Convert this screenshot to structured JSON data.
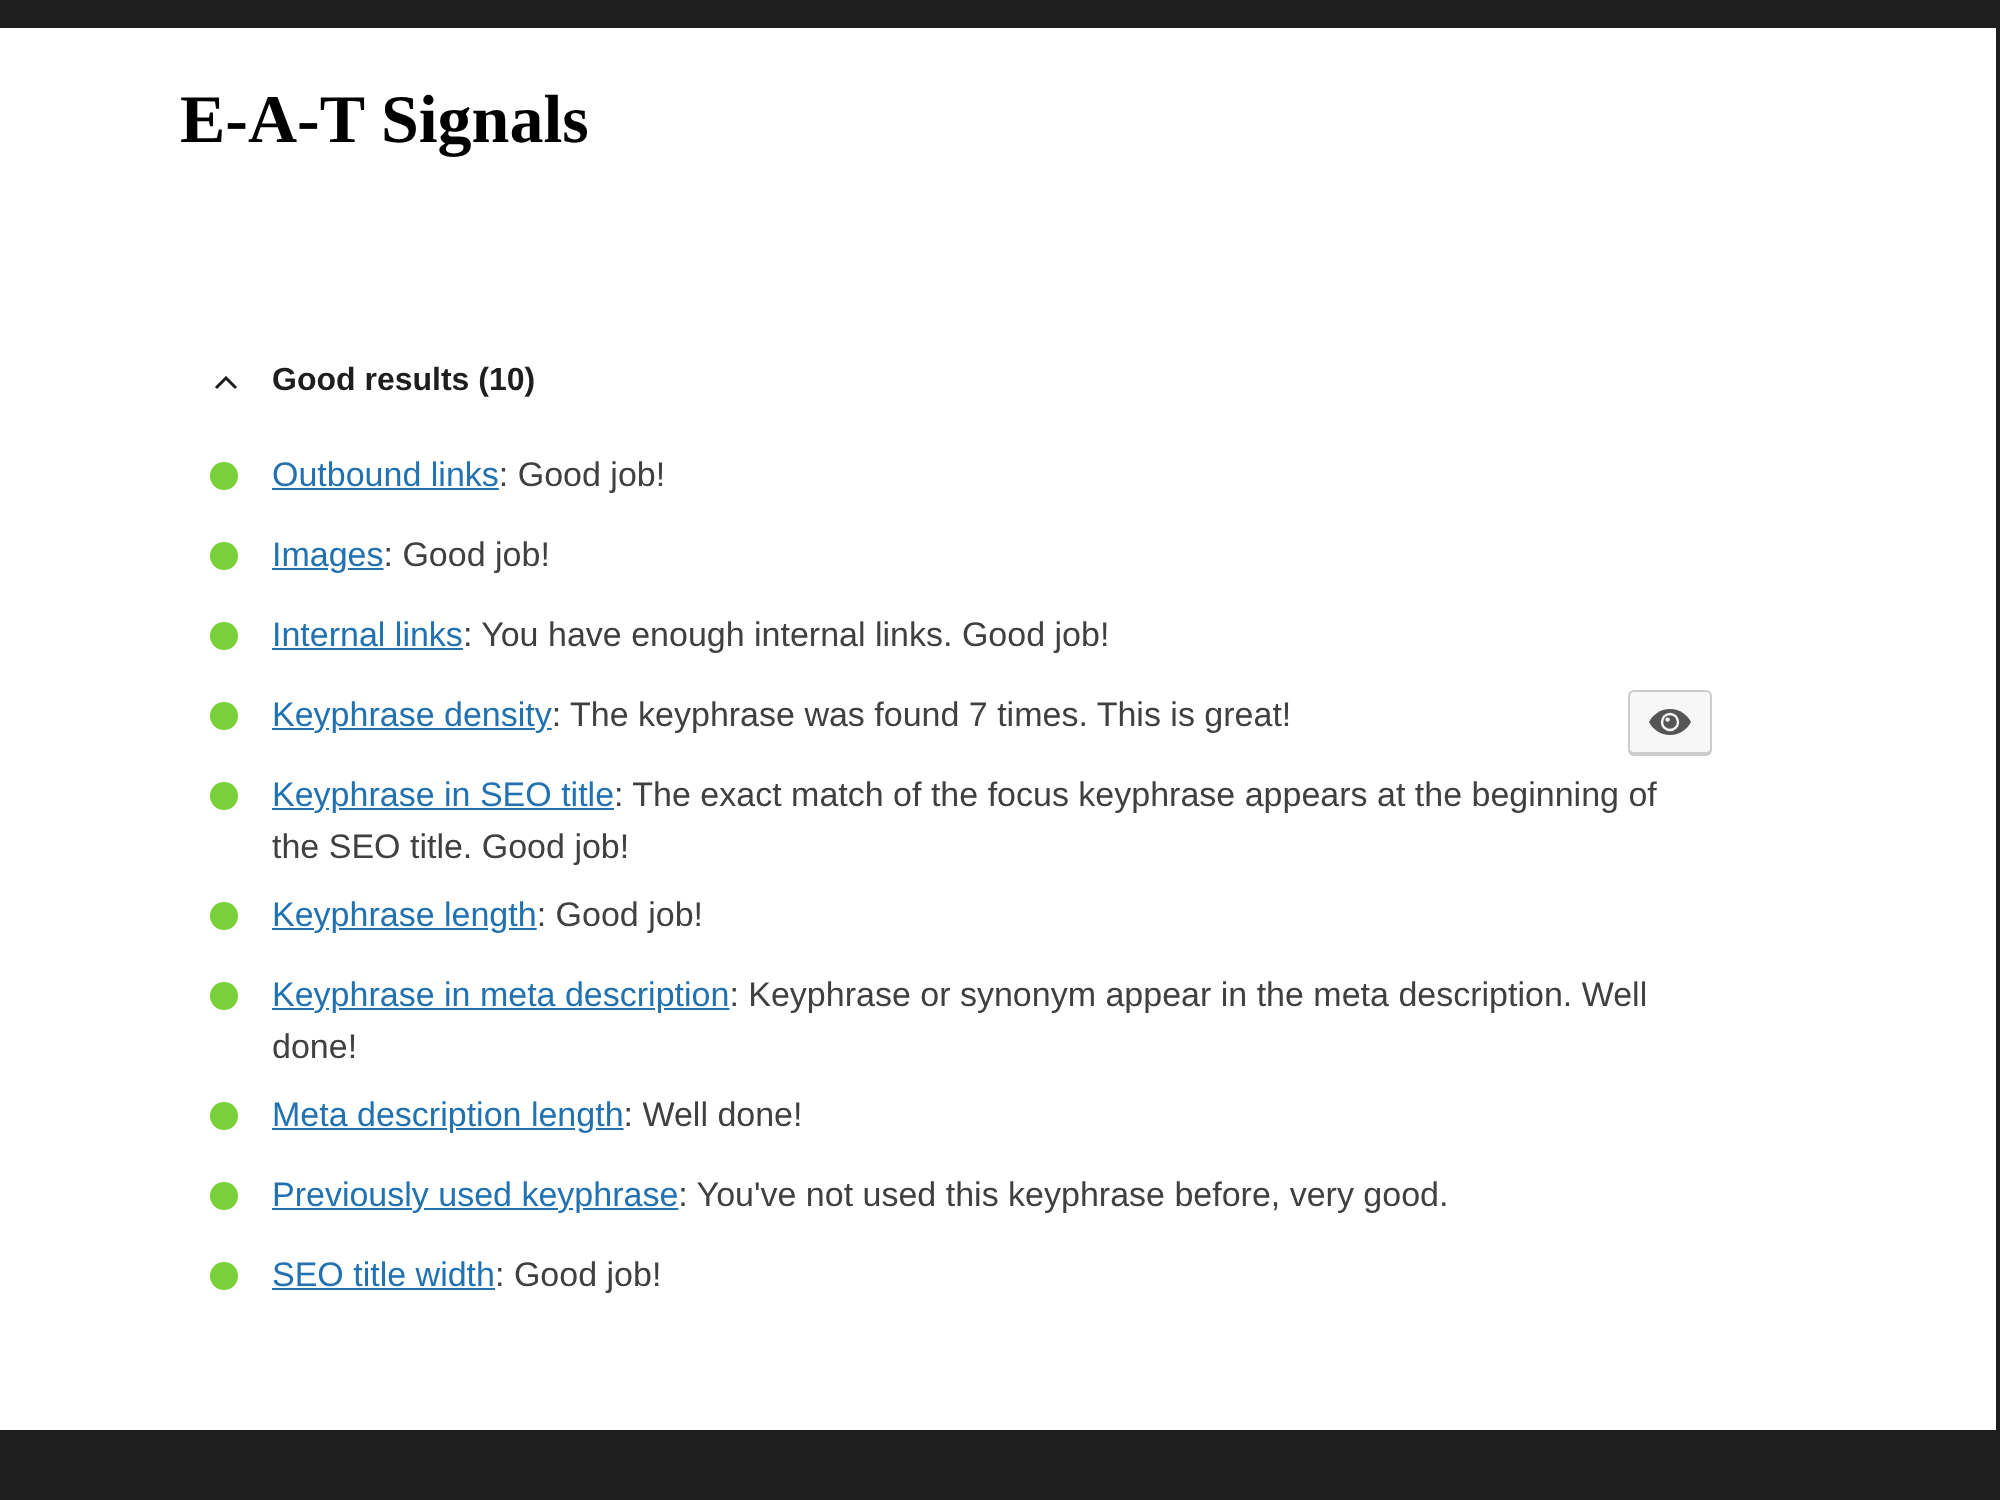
{
  "title": "E-A-T Signals",
  "results": {
    "heading": "Good results (10)",
    "expanded": true,
    "items": [
      {
        "link": "Outbound links",
        "message": ": Good job!",
        "color": "#7ad03a",
        "marker_button": false
      },
      {
        "link": "Images",
        "message": ": Good job!",
        "color": "#7ad03a",
        "marker_button": false
      },
      {
        "link": "Internal links",
        "message": ": You have enough internal links. Good job!",
        "color": "#7ad03a",
        "marker_button": false
      },
      {
        "link": "Keyphrase density",
        "message": ": The keyphrase was found 7 times. This is great!",
        "color": "#7ad03a",
        "marker_button": true
      },
      {
        "link": "Keyphrase in SEO title",
        "message": ": The exact match of the focus keyphrase appears at the beginning of the SEO title. Good job!",
        "color": "#7ad03a",
        "marker_button": false
      },
      {
        "link": "Keyphrase length",
        "message": ": Good job!",
        "color": "#7ad03a",
        "marker_button": false
      },
      {
        "link": "Keyphrase in meta description",
        "message": ": Keyphrase or synonym appear in the meta description. Well done!",
        "color": "#7ad03a",
        "marker_button": false
      },
      {
        "link": "Meta description length",
        "message": ": Well done!",
        "color": "#7ad03a",
        "marker_button": false
      },
      {
        "link": "Previously used keyphrase",
        "message": ": You've not used this keyphrase before, very good.",
        "color": "#7ad03a",
        "marker_button": false
      },
      {
        "link": "SEO title width",
        "message": ": Good job!",
        "color": "#7ad03a",
        "marker_button": false
      }
    ]
  }
}
